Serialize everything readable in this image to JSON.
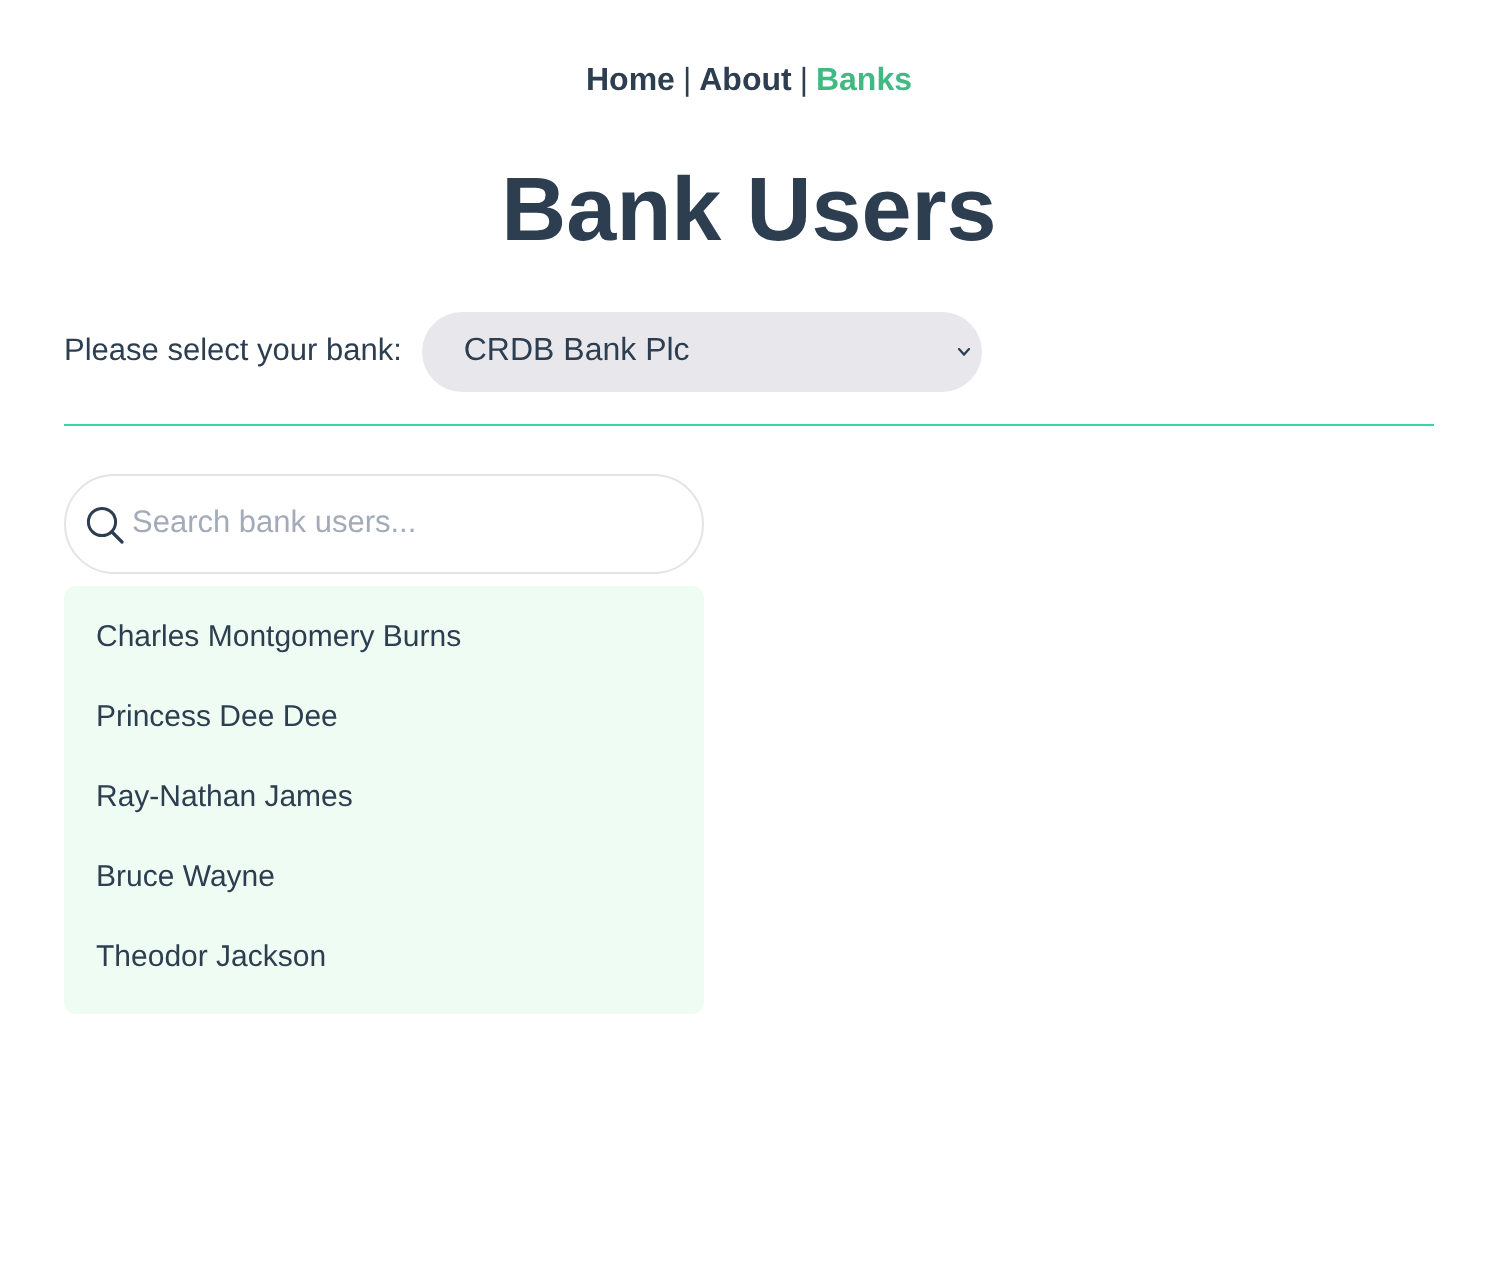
{
  "nav": {
    "items": [
      {
        "kind": "link",
        "label": "Home",
        "selected": false
      },
      {
        "kind": "separator",
        "text": "|"
      },
      {
        "kind": "link",
        "label": "About",
        "selected": false
      },
      {
        "kind": "separator",
        "text": "|"
      },
      {
        "kind": "link",
        "label": "Banks",
        "selected": true
      }
    ]
  },
  "title": "Bank Users",
  "bank_select": {
    "label": "Please select your bank:",
    "value": "CRDB Bank Plc"
  },
  "search": {
    "placeholder": "Search bank users..."
  },
  "users": [
    {
      "name": "Charles Montgomery Burns"
    },
    {
      "name": "Princess Dee Dee"
    },
    {
      "name": "Ray-Nathan James"
    },
    {
      "name": "Bruce Wayne"
    },
    {
      "name": "Theodor Jackson"
    }
  ]
}
